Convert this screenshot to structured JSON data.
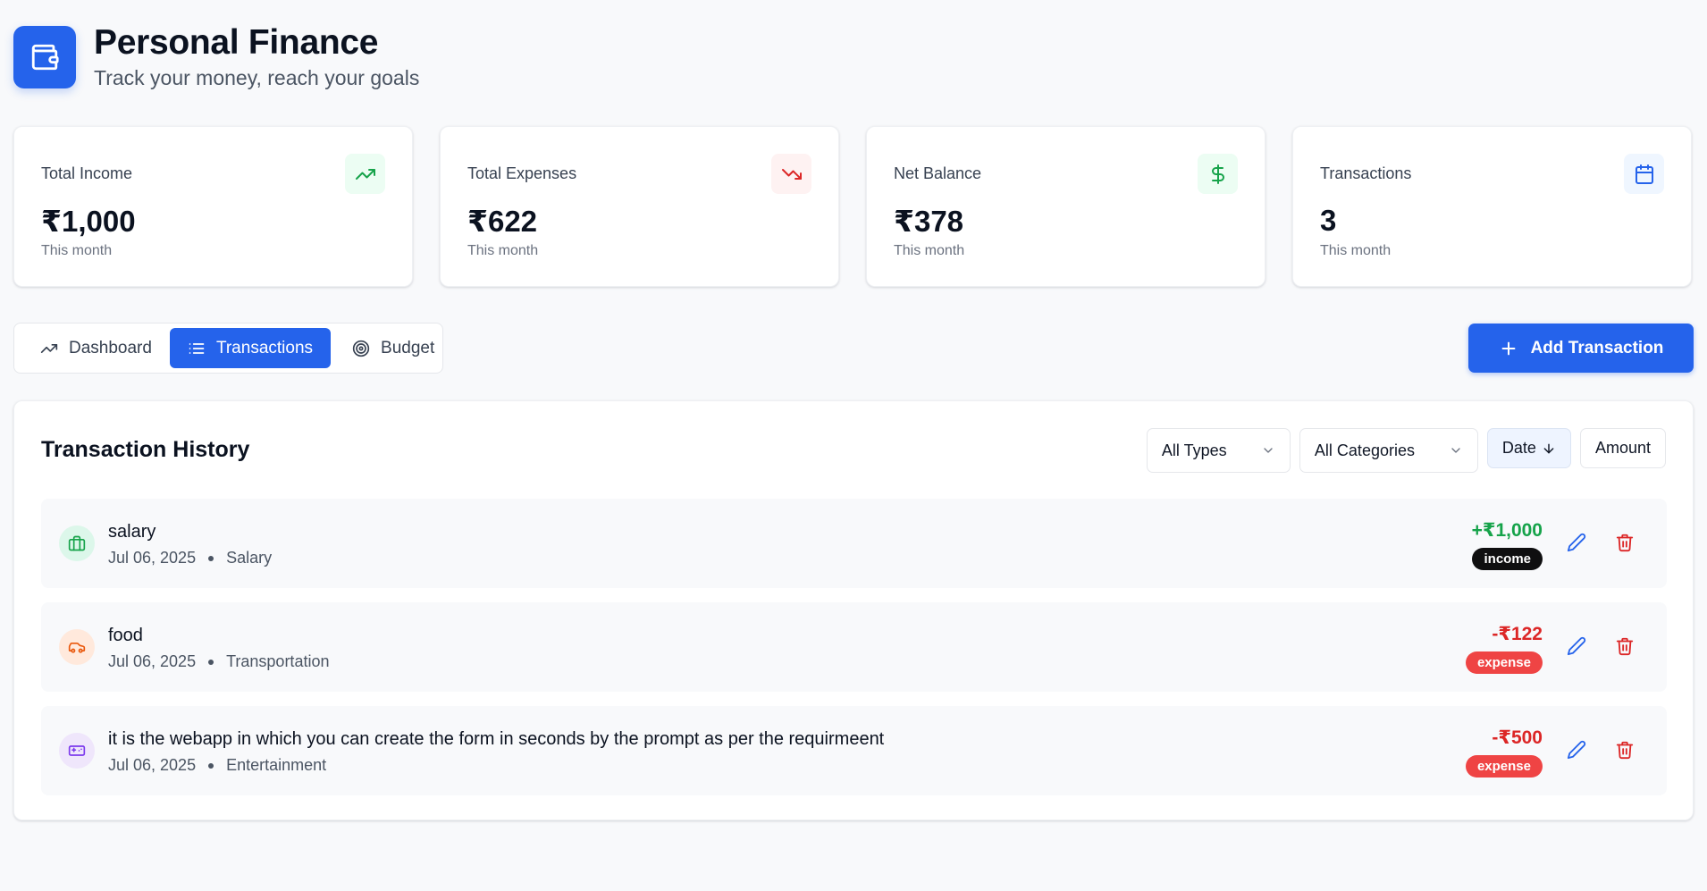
{
  "header": {
    "title": "Personal Finance",
    "subtitle": "Track your money, reach your goals",
    "logo_icon": "wallet-icon",
    "accent": "#2563eb"
  },
  "stats": [
    {
      "label": "Total Income",
      "value": "₹1,000",
      "note": "This month",
      "icon": "trending-up-icon",
      "color": "#16a34a"
    },
    {
      "label": "Total Expenses",
      "value": "₹622",
      "note": "This month",
      "icon": "trending-down-icon",
      "color": "#dc2626"
    },
    {
      "label": "Net Balance",
      "value": "₹378",
      "note": "This month",
      "icon": "dollar-icon",
      "color": "#16a34a"
    },
    {
      "label": "Transactions",
      "value": "3",
      "note": "This month",
      "icon": "calendar-icon",
      "color": "#2563eb"
    }
  ],
  "tabs": [
    {
      "label": "Dashboard",
      "icon": "trending-up-icon",
      "active": false
    },
    {
      "label": "Transactions",
      "icon": "list-icon",
      "active": true
    },
    {
      "label": "Budget",
      "icon": "target-icon",
      "active": false
    }
  ],
  "add_button": {
    "label": "Add Transaction",
    "icon": "plus-icon"
  },
  "history": {
    "title": "Transaction History",
    "type_filter": "All Types",
    "category_filter": "All Categories",
    "sort_date": "Date",
    "sort_amount": "Amount",
    "transactions": [
      {
        "title": "salary",
        "date": "Jul 06, 2025",
        "category": "Salary",
        "amount": "+₹1,000",
        "type": "income",
        "icon": "briefcase-icon"
      },
      {
        "title": "food",
        "date": "Jul 06, 2025",
        "category": "Transportation",
        "amount": "-₹122",
        "type": "expense",
        "icon": "car-icon"
      },
      {
        "title": "it is the webapp in which you can create the form in seconds by the prompt as per the requirmeent",
        "date": "Jul 06, 2025",
        "category": "Entertainment",
        "amount": "-₹500",
        "type": "expense",
        "icon": "gamepad-icon"
      }
    ]
  }
}
